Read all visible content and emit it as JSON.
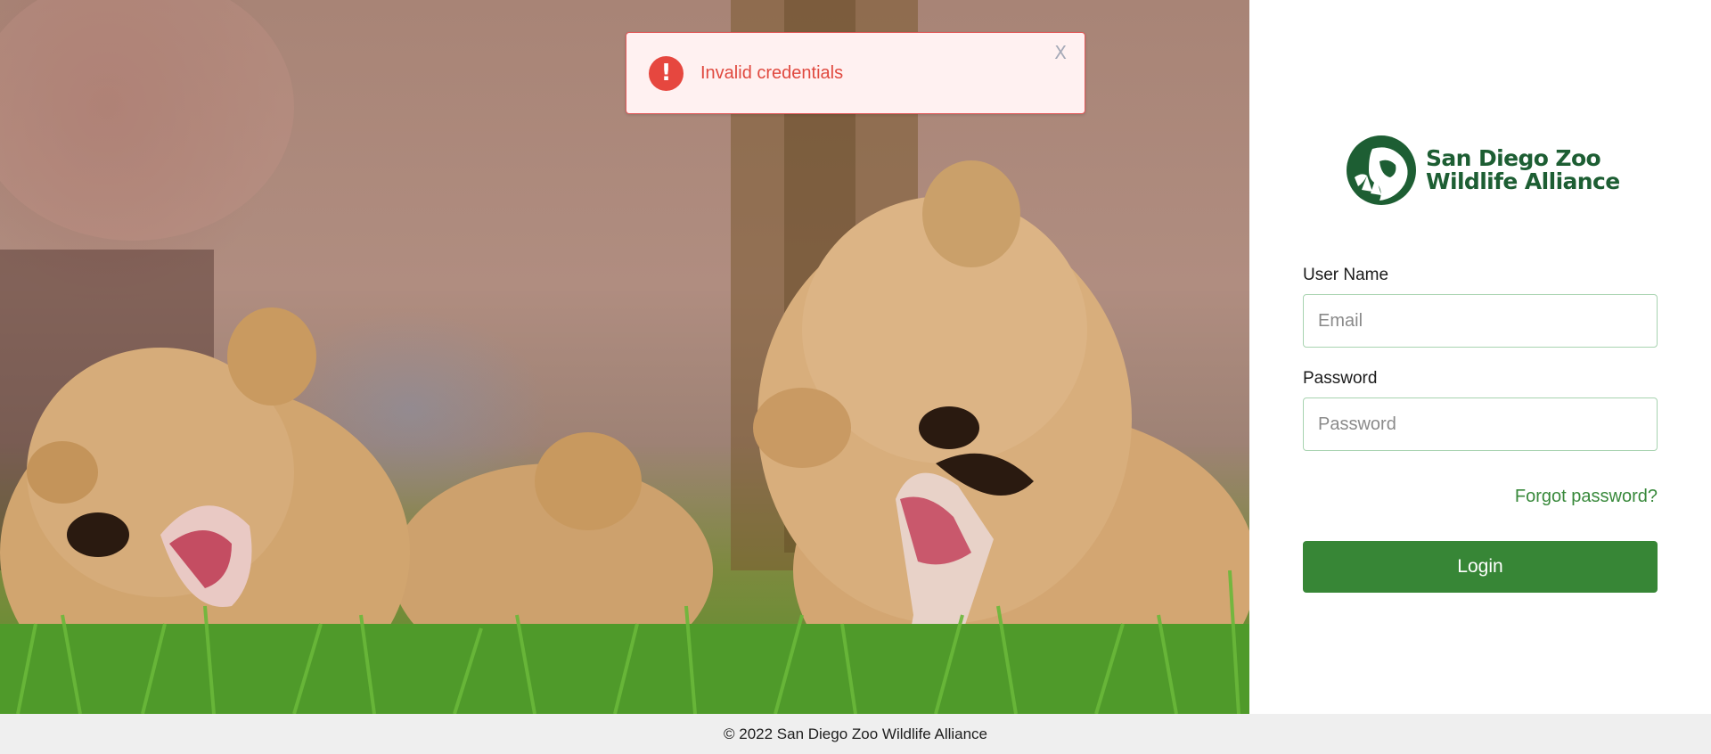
{
  "hero": {
    "image": "Lionesses eating bones on grass"
  },
  "alert": {
    "icon": "exclamation-icon",
    "icon_glyph": "!",
    "message": "Invalid credentials",
    "close_label": "X"
  },
  "logo": {
    "line1": "San Diego Zoo",
    "line2": "Wildlife Alliance"
  },
  "form": {
    "username_label": "User Name",
    "username_placeholder": "Email",
    "username_value": "",
    "password_label": "Password",
    "password_placeholder": "Password",
    "password_value": "",
    "forgot_label": "Forgot password?",
    "login_label": "Login"
  },
  "footer": {
    "text": "© 2022 San Diego Zoo Wildlife Alliance"
  },
  "colors": {
    "brand_green": "#1d5e33",
    "button_green": "#378636",
    "link_green": "#38893b",
    "error_red": "#e0493f",
    "alert_bg": "#fff1f1"
  }
}
